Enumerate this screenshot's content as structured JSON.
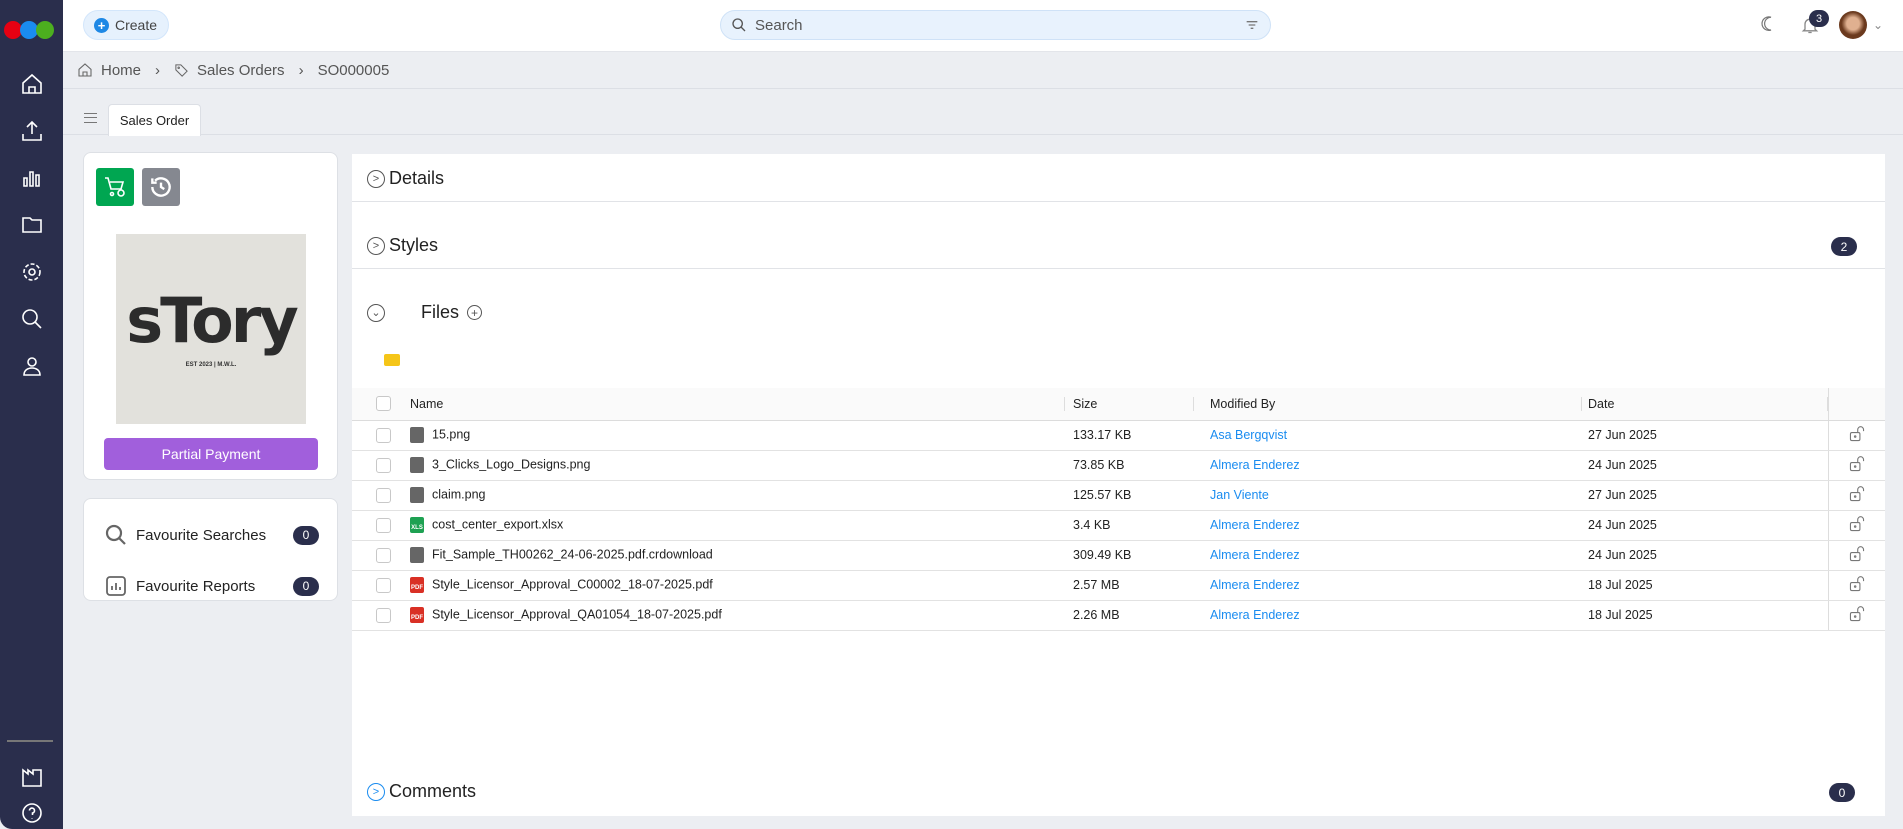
{
  "topbar": {
    "create_label": "Create",
    "search_placeholder": "Search",
    "notification_count": "3"
  },
  "breadcrumb": [
    {
      "label": "Home"
    },
    {
      "label": "Sales Orders"
    },
    {
      "label": "SO000005"
    }
  ],
  "tab": {
    "label": "Sales Order"
  },
  "profile": {
    "logo_text": "sTory",
    "logo_subtext": "EST 2023 | M.W.L.",
    "status_label": "Partial Payment",
    "status_color": "#a15fdc"
  },
  "favourites": [
    {
      "label": "Favourite Searches",
      "count": "0"
    },
    {
      "label": "Favourite Reports",
      "count": "0"
    }
  ],
  "sections": {
    "details": "Details",
    "styles": "Styles",
    "styles_count": "2",
    "files": "Files",
    "comments": "Comments",
    "comments_count": "0"
  },
  "files": {
    "columns": [
      "Name",
      "Size",
      "Modified By",
      "Date"
    ],
    "rows": [
      {
        "name": "15.png",
        "type": "image",
        "size": "133.17 KB",
        "modified_by": "Asa Bergqvist",
        "date": "27 Jun 2025"
      },
      {
        "name": "3_Clicks_Logo_Designs.png",
        "type": "image",
        "size": "73.85 KB",
        "modified_by": "Almera Enderez",
        "date": "24 Jun 2025"
      },
      {
        "name": "claim.png",
        "type": "image",
        "size": "125.57 KB",
        "modified_by": "Jan Viente",
        "date": "27 Jun 2025"
      },
      {
        "name": "cost_center_export.xlsx",
        "type": "xls",
        "size": "3.4 KB",
        "modified_by": "Almera Enderez",
        "date": "24 Jun 2025"
      },
      {
        "name": "Fit_Sample_TH00262_24-06-2025.pdf.crdownload",
        "type": "file",
        "size": "309.49 KB",
        "modified_by": "Almera Enderez",
        "date": "24 Jun 2025"
      },
      {
        "name": "Style_Licensor_Approval_C00002_18-07-2025.pdf",
        "type": "pdf",
        "size": "2.57 MB",
        "modified_by": "Almera Enderez",
        "date": "18 Jul 2025"
      },
      {
        "name": "Style_Licensor_Approval_QA01054_18-07-2025.pdf",
        "type": "pdf",
        "size": "2.26 MB",
        "modified_by": "Almera Enderez",
        "date": "18 Jul 2025"
      }
    ]
  }
}
